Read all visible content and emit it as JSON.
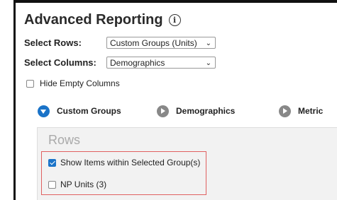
{
  "title": "Advanced Reporting",
  "info_icon": "i",
  "select_rows": {
    "label": "Select Rows:",
    "value": "Custom Groups (Units)"
  },
  "select_columns": {
    "label": "Select Columns:",
    "value": "Demographics"
  },
  "hide_empty_columns": {
    "label": "Hide Empty Columns",
    "checked": false
  },
  "steps": [
    {
      "label": "Custom Groups",
      "state": "expanded"
    },
    {
      "label": "Demographics",
      "state": "collapsed"
    },
    {
      "label": "Metric",
      "state": "collapsed"
    }
  ],
  "rows_panel": {
    "title": "Rows",
    "show_items": {
      "label": "Show Items within Selected Group(s)",
      "checked": true
    },
    "np_units": {
      "label": "NP Units (3)",
      "checked": false
    }
  },
  "colors": {
    "accent": "#1a73c8",
    "highlight_border": "#e06060",
    "panel_bg": "#f2f2f2"
  }
}
